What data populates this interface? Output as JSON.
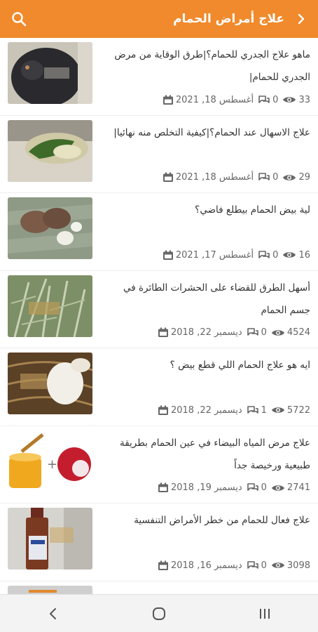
{
  "header": {
    "title": "علاج أمراض الحمام",
    "search_icon": "search-icon",
    "back_icon": "chevron-left-icon",
    "color": "#f08a2c"
  },
  "articles": [
    {
      "title": "ماهو علاج الجدري للحمام؟|طرق الوقاية من مرض الجدري للحمام|",
      "views": "33",
      "comments": "0",
      "date": "أغسطس 18, 2021"
    },
    {
      "title": "علاج الاسهال عند الحمام؟|كيفية التخلص منه نهائيا|",
      "views": "29",
      "comments": "0",
      "date": "أغسطس 18, 2021"
    },
    {
      "title": "لية بيض الحمام بيطلع فاضي؟",
      "views": "16",
      "comments": "0",
      "date": "أغسطس 17, 2021"
    },
    {
      "title": "أسهل الطرق للقضاء على الحشرات الطائرة في جسم الحمام",
      "views": "4524",
      "comments": "0",
      "date": "ديسمبر 22, 2018"
    },
    {
      "title": "ايه هو علاج الحمام اللي قطع بيض ؟",
      "views": "5722",
      "comments": "1",
      "date": "ديسمبر 22, 2018"
    },
    {
      "title": "علاج مرض المياه البيضاء في عين الحمام بطريقة طبيعية ورخيصة جداً",
      "views": "2741",
      "comments": "0",
      "date": "ديسمبر 19, 2018"
    },
    {
      "title": "علاج فعال للحمام من خطر الأمراض التنفسية",
      "views": "3098",
      "comments": "0",
      "date": "ديسمبر 16, 2018"
    },
    {
      "title": "",
      "views": "",
      "comments": "",
      "date": ""
    }
  ],
  "navbar": {
    "back_icon": "back-icon",
    "home_icon": "home-icon",
    "recents_icon": "recents-icon"
  }
}
